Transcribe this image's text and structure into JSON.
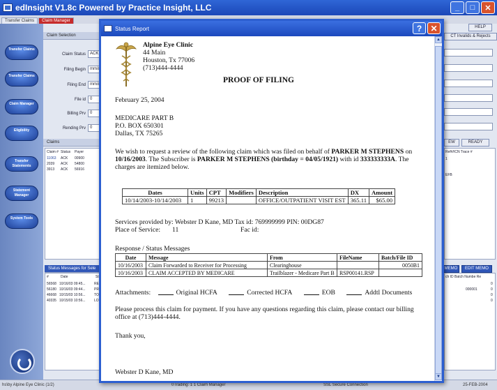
{
  "window": {
    "title": "edInsight V1.8c Powered by Practice Insight, LLC",
    "min": "_",
    "max": "□",
    "close": "✕"
  },
  "tabs": [
    "Transfer Claims",
    "Claim Manager"
  ],
  "nav": [
    "Transfer Claims",
    "Transfer Claims",
    "Claim Manager",
    "Eligibility",
    "Transfer Statements",
    "Statement Manager",
    "System Tools"
  ],
  "claim_selection": {
    "header": "Claim Selection",
    "claim_status_label": "Claim Status",
    "claim_status": "ACK",
    "filing_begin_label": "Filing Begin",
    "filing_begin": "mm/dd/yy",
    "filing_end_label": "Filing End",
    "filing_end": "mm/dd/yy",
    "file_id_label": "File id",
    "file_id": "0",
    "billing_prv_label": "Billing Prv",
    "billing_prv": "0",
    "rending_prv_label": "Rending Prv",
    "rending_prv": "0"
  },
  "claims": {
    "header": "Claims",
    "columns": [
      "Claim #",
      "Status",
      "Payer"
    ],
    "rows": [
      [
        "11063",
        "ACK",
        "00900"
      ],
      [
        "2039",
        "ACK",
        "54800"
      ],
      [
        "3913",
        "ACK",
        "56916"
      ]
    ]
  },
  "status_messages": {
    "header": "Status Messages for Sele",
    "columns": [
      "#",
      "Date",
      "St"
    ],
    "rows": [
      [
        "56568",
        "10/16/03 09:45...",
        "RE"
      ],
      [
        "56180",
        "10/16/03 09:44...",
        "PR"
      ],
      [
        "46668",
        "10/15/03 10:56...",
        "TO"
      ],
      [
        "40335",
        "10/15/03 10:56...",
        "LO"
      ]
    ]
  },
  "right_panel": {
    "help": "HELP",
    "invalids": "CT Invalids & Rejects",
    "view": "EW",
    "ready": "READY",
    "trace_hdr": "Ref#/ICN Trace #",
    "trace_val": "1",
    "efb": "EFB",
    "memo": "MEMO",
    "edit_memo": "EDIT MEMO",
    "batch_hdr": "ch ID Batch Numbe Re",
    "batch_vals": [
      "0",
      "0",
      "0",
      "0"
    ],
    "batch_id": "000001"
  },
  "statusbar": {
    "left": "hs\\by Alpine Eye Clinic (1/2)",
    "mid": "0Trading:  1 1 Claim Manager",
    "conn": "SSL Secure Connection",
    "date": "25-FEB-2004"
  },
  "dialog": {
    "title": "Status Report",
    "help": "?",
    "close": "✕",
    "clinic": {
      "name": "Alpine Eye Clinic",
      "addr1": "44 Main",
      "addr2": "Houston, Tx 77006",
      "phone": "(713)444-4444"
    },
    "heading": "PROOF OF FILING",
    "date": "February 25, 2004",
    "payer": {
      "line1": "MEDICARE PART B",
      "line2": "P.O. BOX 650301",
      "line3": "Dallas, TX 75265"
    },
    "body1a": "We wish to request a review of the following claim which was filed on behalf of ",
    "patient": "PARKER M STEPHENS",
    "body1b": " on ",
    "filed_date": "10/16/2003",
    "body1c": ". The Subscriber is ",
    "subscriber": "PARKER M STEPHENS (birthday = 04/05/1921)",
    "body1d": " with id ",
    "sub_id": "333333333A",
    "body1e": ". The charges are itemized below.",
    "charges": {
      "columns": [
        "Dates",
        "Units",
        "CPT",
        "Modifiers",
        "Description",
        "DX",
        "Amount"
      ],
      "rows": [
        [
          "10/14/2003-10/14/2003",
          "1",
          "99213",
          "",
          "OFFICE/OUTPATIENT VISIT EST",
          "365.11",
          "$65.00"
        ]
      ]
    },
    "services_line": "Services provided by:  Webster D Kane, MD  Tax id: 769999999   PIN: 00DG87",
    "place_label": "Place of Service:",
    "place_val": "11",
    "fac_label": "Fac id:",
    "response_label": "Response / Status Messages",
    "messages": {
      "columns": [
        "Date",
        "Message",
        "From",
        "FileName",
        "Batch/File ID"
      ],
      "rows": [
        [
          "10/16/2003",
          "Claim Forwarded to Receiver for Processing",
          "Clearinghouse",
          "",
          "0050B1"
        ],
        [
          "10/16/2003",
          "CLAIM ACCEPTED BY MEDICARE",
          "Trailblazer - Medicare Part B",
          "RSP00141.RSP",
          ""
        ]
      ]
    },
    "attachments_label": "Attachments:",
    "attachments": [
      "Original HCFA",
      "Corrected HCFA",
      "EOB",
      "Addtl Documents"
    ],
    "closing": "Please process this claim for payment. If you have any questions regarding this claim, please contact our billing office at (713)444-4444.",
    "thanks": "Thank you,",
    "signature": "Webster D Kane, MD"
  },
  "colors": {
    "titlebar": "#1b47b8",
    "dialog_border": "#2c5fd1",
    "close_btn": "#d9532c",
    "app_bg": "#8fa7cf"
  }
}
